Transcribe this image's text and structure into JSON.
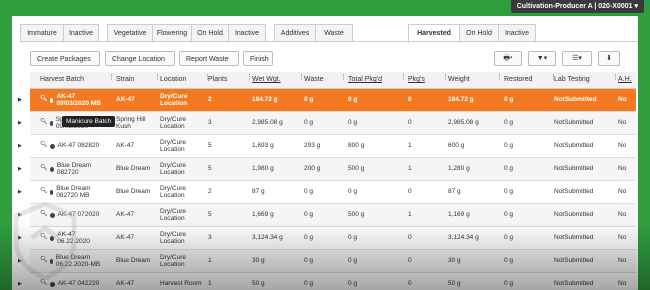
{
  "facility": "Cultivation-Producer A | 020-X0001 ▾",
  "tabs": [
    {
      "label": "Immature"
    },
    {
      "label": "Inactive"
    },
    {
      "label": "Vegetative"
    },
    {
      "label": "Flowering"
    },
    {
      "label": "On Hold"
    },
    {
      "label": "Inactive"
    },
    {
      "label": "Additives"
    },
    {
      "label": "Waste"
    },
    {
      "label": "Harvested"
    },
    {
      "label": "On Hold"
    },
    {
      "label": "Inactive"
    }
  ],
  "toolbar": {
    "create_packages": "Create Packages",
    "change_location": "Change Location",
    "report_waste": "Report Waste",
    "finish": "Finish",
    "print_label": "🖶▾",
    "filter_label": "▼▾",
    "columns_label": "☰▾",
    "download_label": "⬇"
  },
  "columns": [
    "Harvest Batch",
    "Strain",
    "Location",
    "Plants",
    "Wet Wgt.",
    "Waste",
    "Total Pkg'd",
    "Pkg's",
    "Weight",
    "Restored",
    "Lab Testing",
    "A.H."
  ],
  "tooltip": "Manicure Batch",
  "rows": [
    {
      "batch": "AK-47 09/03/2020 MB",
      "strain": "AK-47",
      "location": "Dry/Cure Location",
      "plants": "2",
      "wet": "184.72 g",
      "waste": "0 g",
      "total": "0 g",
      "pkgs": "0",
      "weight": "184.72 g",
      "restored": "0 g",
      "lab": "NotSubmitted",
      "ah": "No"
    },
    {
      "batch": "Spring Hill Kush 09/03/2020",
      "strain": "Spring Hill Kush",
      "location": "Dry/Cure Location",
      "plants": "3",
      "wet": "2,985.08 g",
      "waste": "0 g",
      "total": "0 g",
      "pkgs": "0",
      "weight": "2,985.08 g",
      "restored": "0 g",
      "lab": "NotSubmitted",
      "ah": "No"
    },
    {
      "batch": "AK-47 082820",
      "strain": "AK-47",
      "location": "Dry/Cure Location",
      "plants": "5",
      "wet": "1,693 g",
      "waste": "293 g",
      "total": "800 g",
      "pkgs": "1",
      "weight": "600 g",
      "restored": "0 g",
      "lab": "NotSubmitted",
      "ah": "No"
    },
    {
      "batch": "Blue Dream 082720",
      "strain": "Blue Dream",
      "location": "Dry/Cure Location",
      "plants": "5",
      "wet": "1,980 g",
      "waste": "200 g",
      "total": "500 g",
      "pkgs": "1",
      "weight": "1,280 g",
      "restored": "0 g",
      "lab": "NotSubmitted",
      "ah": "No"
    },
    {
      "batch": "Blue Dream 082720 MB",
      "strain": "Blue Dream",
      "location": "Dry/Cure Location",
      "plants": "2",
      "wet": "87 g",
      "waste": "0 g",
      "total": "0 g",
      "pkgs": "0",
      "weight": "87 g",
      "restored": "0 g",
      "lab": "NotSubmitted",
      "ah": "No"
    },
    {
      "batch": "AK-47 072020",
      "strain": "AK-47",
      "location": "Dry/Cure Location",
      "plants": "5",
      "wet": "1,669 g",
      "waste": "0 g",
      "total": "500 g",
      "pkgs": "1",
      "weight": "1,169 g",
      "restored": "0 g",
      "lab": "NotSubmitted",
      "ah": "No"
    },
    {
      "batch": "AK-47 06.22.2020",
      "strain": "AK-47",
      "location": "Dry/Cure Location",
      "plants": "3",
      "wet": "3,124.34 g",
      "waste": "0 g",
      "total": "0 g",
      "pkgs": "0",
      "weight": "3,124.34 g",
      "restored": "0 g",
      "lab": "NotSubmitted",
      "ah": "No"
    },
    {
      "batch": "Blue Dream 06.22.2020-MB",
      "strain": "Blue Dream",
      "location": "Dry/Cure Location",
      "plants": "1",
      "wet": "30 g",
      "waste": "0 g",
      "total": "0 g",
      "pkgs": "0",
      "weight": "30 g",
      "restored": "0 g",
      "lab": "NotSubmitted",
      "ah": "No"
    },
    {
      "batch": "AK-47 042220",
      "strain": "AK-47",
      "location": "Harvest Room",
      "plants": "1",
      "wet": "50 g",
      "waste": "0 g",
      "total": "0 g",
      "pkgs": "0",
      "weight": "50 g",
      "restored": "0 g",
      "lab": "NotSubmitted",
      "ah": "No"
    }
  ],
  "colors": {
    "selected_row": "#f47920",
    "background": "#2f9e3f"
  }
}
